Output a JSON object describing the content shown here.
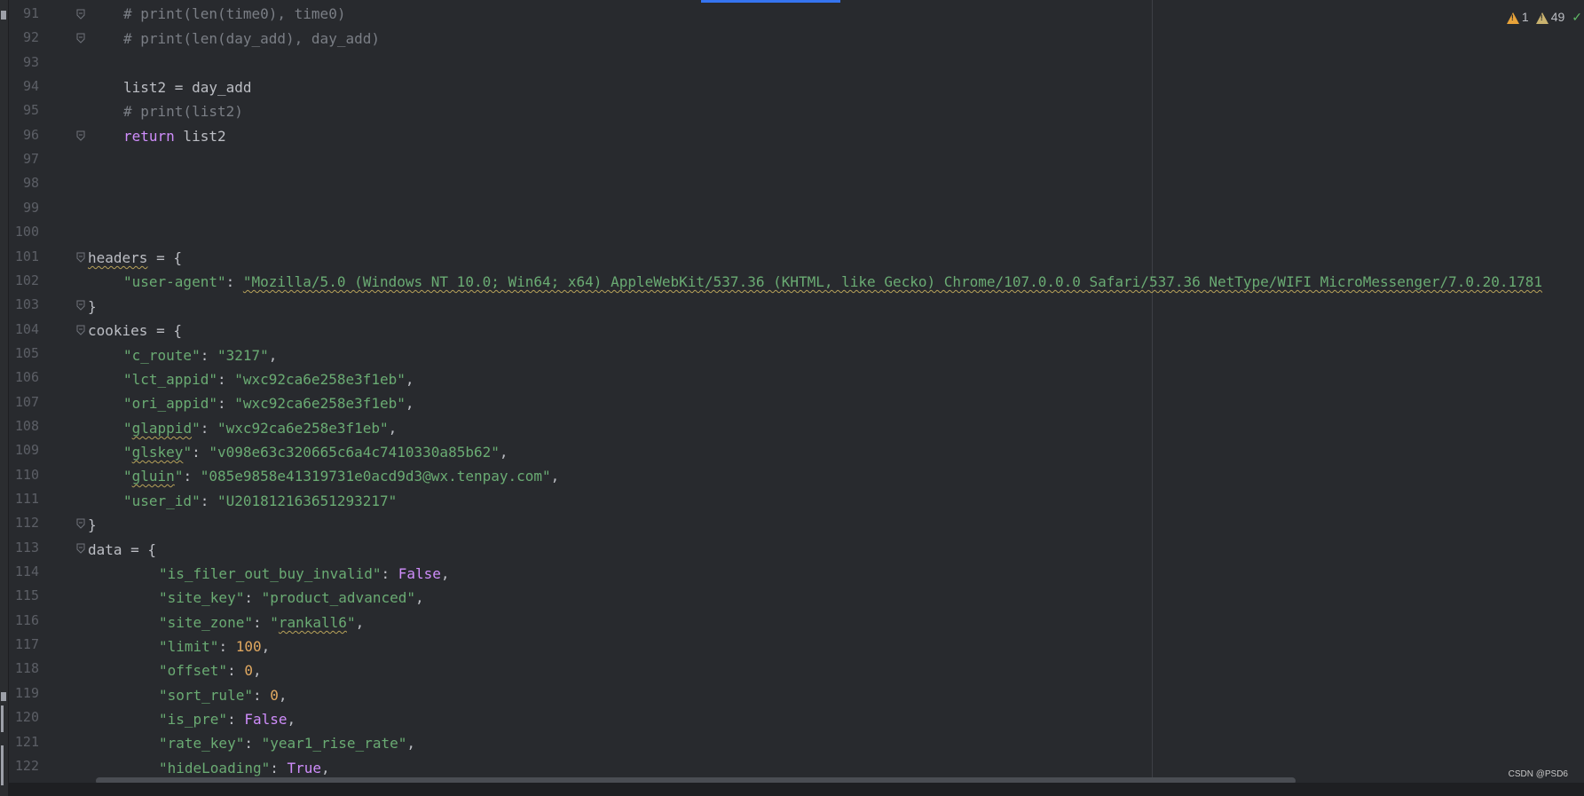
{
  "inspections": {
    "warnings": "1",
    "weak_warnings": "49"
  },
  "watermark": "CSDN @PSD6",
  "gutter": [
    "91",
    "92",
    "93",
    "94",
    "95",
    "96",
    "97",
    "98",
    "99",
    "100",
    "101",
    "102",
    "103",
    "104",
    "105",
    "106",
    "107",
    "108",
    "109",
    "110",
    "111",
    "112",
    "113",
    "114",
    "115",
    "116",
    "117",
    "118",
    "119",
    "120",
    "121",
    "122"
  ],
  "code": {
    "l91": "# print(len(time0), time0)",
    "l92": "# print(len(day_add), day_add)",
    "l94": "list2 = day_add",
    "l95": "# print(list2)",
    "l96_kw": "return",
    "l96_rest": " list2",
    "l101_a": "headers",
    "l101_b": " = {",
    "l102_key": "\"user-agent\"",
    "l102_colon": ": ",
    "l102_val": "\"Mozilla/5.0 (Windows NT 10.0; Win64; x64) AppleWebKit/537.36 (KHTML, like Gecko) Chrome/107.0.0.0 Safari/537.36 NetType/WIFI MicroMessenger/7.0.20.1781",
    "l103": "}",
    "l104": "cookies = {",
    "l105_key": "\"c_route\"",
    "l105_val": "\"3217\"",
    "l106_key": "\"lct_appid\"",
    "l106_val": "\"wxc92ca6e258e3f1eb\"",
    "l107_key": "\"ori_appid\"",
    "l107_val": "\"wxc92ca6e258e3f1eb\"",
    "l108_q": "\"",
    "l108_w": "glappid",
    "l108_q2": "\"",
    "l108_val": "\"wxc92ca6e258e3f1eb\"",
    "l109_w": "glskey",
    "l109_val": "\"v098e63c320665c6a4c7410330a85b62\"",
    "l110_w": "gluin",
    "l110_val": "\"085e9858e41319731e0acd9d3@wx.tenpay.com\"",
    "l111_key": "\"user_id\"",
    "l111_val": "\"U201812163651293217\"",
    "l112": "}",
    "l113": "data = {",
    "l114_key": "\"is_filer_out_buy_invalid\"",
    "l114_val": "False",
    "l115_key": "\"site_key\"",
    "l115_val": "\"product_advanced\"",
    "l116_key": "\"site_zone\"",
    "l116_v1": "\"",
    "l116_w": "rankall6",
    "l116_v2": "\"",
    "l117_key": "\"limit\"",
    "l117_val": "100",
    "l118_key": "\"offset\"",
    "l118_val": "0",
    "l119_key": "\"sort_rule\"",
    "l119_val": "0",
    "l120_key": "\"is_pre\"",
    "l120_val": "False",
    "l121_key": "\"rate_key\"",
    "l121_val": "\"year1_rise_rate\"",
    "l122_key": "\"hideLoading\"",
    "l122_val": "True",
    "comma": ",",
    "colon": ": "
  }
}
